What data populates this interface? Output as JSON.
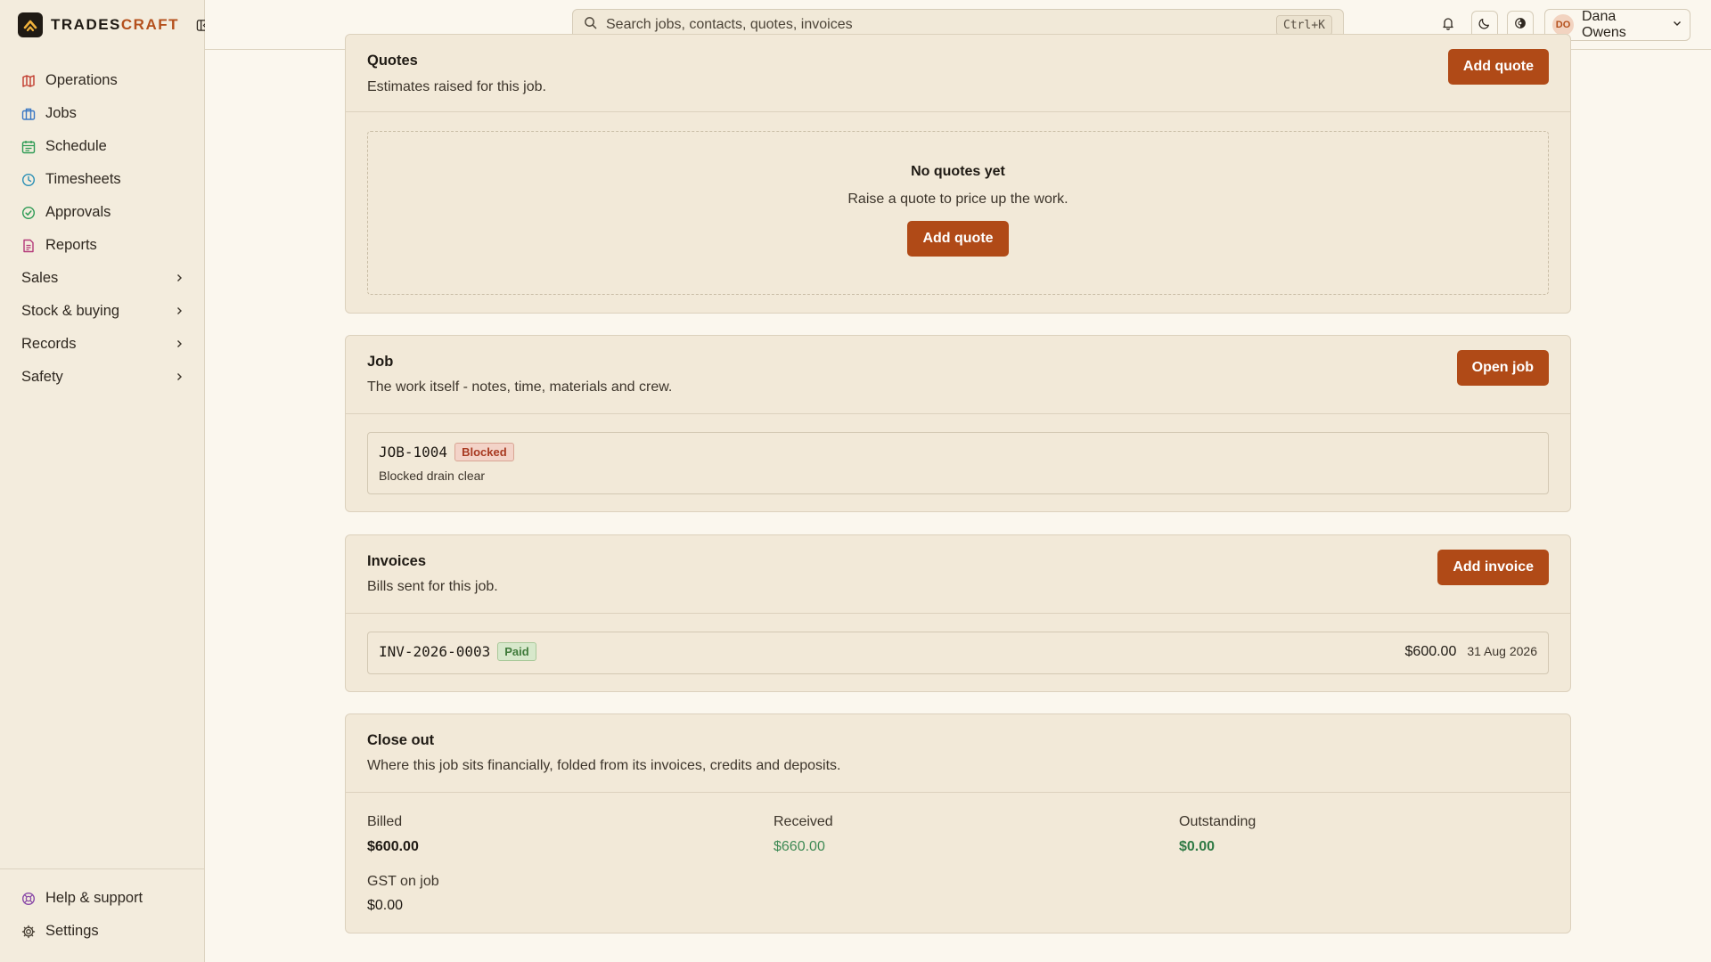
{
  "brand": {
    "name_part1": "TRADES",
    "name_part2": "CRAFT"
  },
  "sidebar": {
    "items": [
      {
        "label": "Operations",
        "icon": "map-icon",
        "color": "#c0392b"
      },
      {
        "label": "Jobs",
        "icon": "briefcase-icon",
        "color": "#3b78c4"
      },
      {
        "label": "Schedule",
        "icon": "calendar-icon",
        "color": "#2e9b55"
      },
      {
        "label": "Timesheets",
        "icon": "clock-icon",
        "color": "#2a8fb5"
      },
      {
        "label": "Approvals",
        "icon": "check-circle-icon",
        "color": "#2e9b55"
      },
      {
        "label": "Reports",
        "icon": "document-icon",
        "color": "#b43a7a"
      }
    ],
    "groups": [
      {
        "label": "Sales"
      },
      {
        "label": "Stock & buying"
      },
      {
        "label": "Records"
      },
      {
        "label": "Safety"
      }
    ],
    "footer": [
      {
        "label": "Help & support",
        "icon": "lifebuoy-icon"
      },
      {
        "label": "Settings",
        "icon": "gear-icon"
      }
    ]
  },
  "topbar": {
    "search_placeholder": "Search jobs, contacts, quotes, invoices",
    "shortcut": "Ctrl+K",
    "user_initials": "DO",
    "user_name": "Dana Owens"
  },
  "quotes": {
    "title": "Quotes",
    "subtitle": "Estimates raised for this job.",
    "add_label": "Add quote",
    "empty_title": "No quotes yet",
    "empty_subtitle": "Raise a quote to price up the work.",
    "empty_button": "Add quote"
  },
  "job": {
    "title": "Job",
    "subtitle": "The work itself - notes, time, materials and crew.",
    "open_label": "Open job",
    "id": "JOB-1004",
    "status": "Blocked",
    "description": "Blocked drain clear"
  },
  "invoices": {
    "title": "Invoices",
    "subtitle": "Bills sent for this job.",
    "add_label": "Add invoice",
    "rows": [
      {
        "id": "INV-2026-0003",
        "status": "Paid",
        "amount": "$600.00",
        "date": "31 Aug 2026"
      }
    ]
  },
  "closeout": {
    "title": "Close out",
    "subtitle": "Where this job sits financially, folded from its invoices, credits and deposits.",
    "billed_label": "Billed",
    "billed_value": "$600.00",
    "received_label": "Received",
    "received_value": "$660.00",
    "outstanding_label": "Outstanding",
    "outstanding_value": "$0.00",
    "gst_label": "GST on job",
    "gst_value": "$0.00"
  },
  "colors": {
    "accent": "#b04a17",
    "positive": "#3f8a55",
    "blocked": "#a83a22",
    "paid": "#3f7a3a"
  }
}
